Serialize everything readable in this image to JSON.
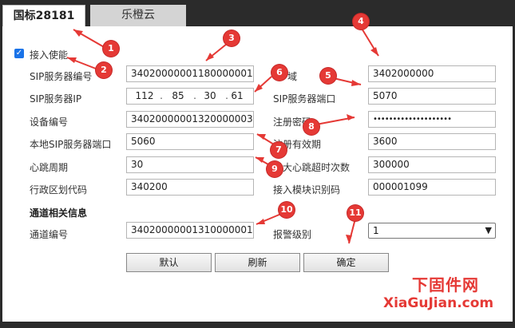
{
  "tabs": [
    {
      "label": "国标28181",
      "active": true
    },
    {
      "label": "乐橙云",
      "active": false
    }
  ],
  "enable": {
    "label": "接入使能",
    "checked": true
  },
  "left_fields": [
    {
      "label": "SIP服务器编号",
      "value": "34020000001180000001"
    },
    {
      "label": "SIP服务器IP",
      "value": ""
    },
    {
      "label": "设备编号",
      "value": "34020000001320000003"
    },
    {
      "label": "本地SIP服务器端口",
      "value": "5060"
    },
    {
      "label": "心跳周期",
      "value": "30"
    },
    {
      "label": "行政区划代码",
      "value": "340200"
    }
  ],
  "sip_ip": [
    "112",
    "85",
    "30",
    "61"
  ],
  "right_fields": [
    {
      "label": "域",
      "value": "3402000000"
    },
    {
      "label": "SIP服务器端口",
      "value": "5070"
    },
    {
      "label": "注册密码",
      "value": "••••••••••••••••••••"
    },
    {
      "label": "注册有效期",
      "value": "3600"
    },
    {
      "label": "最大心跳超时次数",
      "value": "300000"
    },
    {
      "label": "接入模块识别码",
      "value": "000001099"
    }
  ],
  "channel_section": {
    "title": "通道相关信息",
    "channel_label": "通道编号",
    "channel_value": "34020000001310000001",
    "alarm_label": "报警级别",
    "alarm_value": "1"
  },
  "buttons": {
    "default": "默认",
    "refresh": "刷新",
    "ok": "确定"
  },
  "markers": [
    "1",
    "2",
    "3",
    "4",
    "5",
    "6",
    "7",
    "8",
    "9",
    "10",
    "11"
  ],
  "watermark": {
    "line1": "下固件网",
    "line2": "XiaGuJian.com"
  },
  "colors": {
    "marker": "#e53935",
    "checkbox": "#1a73e8",
    "tab_bar": "#2b2b2b"
  }
}
